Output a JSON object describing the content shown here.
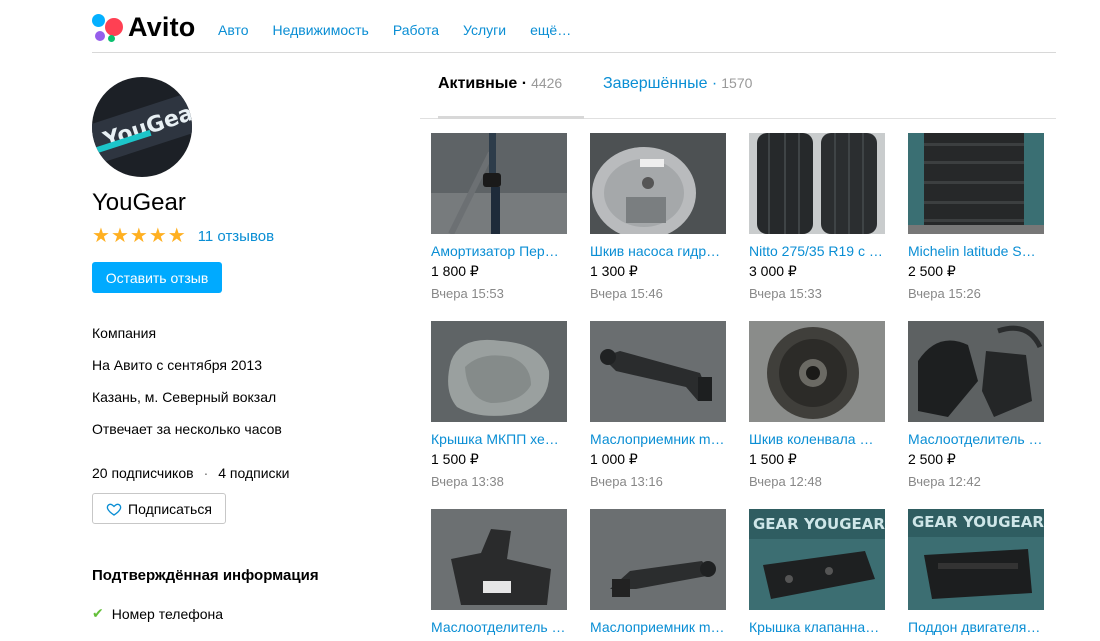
{
  "header": {
    "logo_text": "Avito",
    "nav": [
      "Авто",
      "Недвижимость",
      "Работа",
      "Услуги",
      "ещё…"
    ]
  },
  "profile": {
    "avatar_label": "YouGear",
    "name": "YouGear",
    "rating_stars": 5,
    "reviews_link": "11 отзывов",
    "review_button": "Оставить отзыв",
    "type": "Компания",
    "since": "На Авито с сентября 2013",
    "location": "Казань, м. Северный вокзал",
    "response": "Отвечает за несколько часов",
    "subscribers": "20 подписчиков",
    "subscriptions": "4 подписки",
    "subscribe_button": "Подписаться",
    "verified_title": "Подтверждённая информация",
    "verified_items": [
      "Номер телефона"
    ]
  },
  "tabs": {
    "active_label": "Активные ·",
    "active_count": "4426",
    "done_label": "Завершённые ·",
    "done_count": "1570"
  },
  "listings": [
    {
      "title": "Амортизатор Пер…",
      "price": "1 800 ₽",
      "time": "Вчера 15:53"
    },
    {
      "title": "Шкив насоса гидр…",
      "price": "1 300 ₽",
      "time": "Вчера 15:46"
    },
    {
      "title": "Nitto 275/35 R19 с …",
      "price": "3 000 ₽",
      "time": "Вчера 15:33"
    },
    {
      "title": "Michelin latitude S…",
      "price": "2 500 ₽",
      "time": "Вчера 15:26"
    },
    {
      "title": "Крышка МКПП хе…",
      "price": "1 500 ₽",
      "time": "Вчера 13:38"
    },
    {
      "title": "Маслоприемник m…",
      "price": "1 000 ₽",
      "time": "Вчера 13:16"
    },
    {
      "title": "Шкив коленвала …",
      "price": "1 500 ₽",
      "time": "Вчера 12:48"
    },
    {
      "title": "Маслоотделитель …",
      "price": "2 500 ₽",
      "time": "Вчера 12:42"
    },
    {
      "title": "Маслоотделитель …",
      "price": "",
      "time": ""
    },
    {
      "title": "Маслоприемник m…",
      "price": "",
      "time": ""
    },
    {
      "title": "Крышка клапанна…",
      "price": "",
      "time": ""
    },
    {
      "title": "Поддон двигателя…",
      "price": "",
      "time": ""
    }
  ],
  "thumb_watermark": "GEAR YOUGEAR",
  "colors": {
    "link": "#0a8ed4",
    "primary_button": "#00aaff",
    "star": "#ffb021",
    "check": "#64bf3a"
  }
}
